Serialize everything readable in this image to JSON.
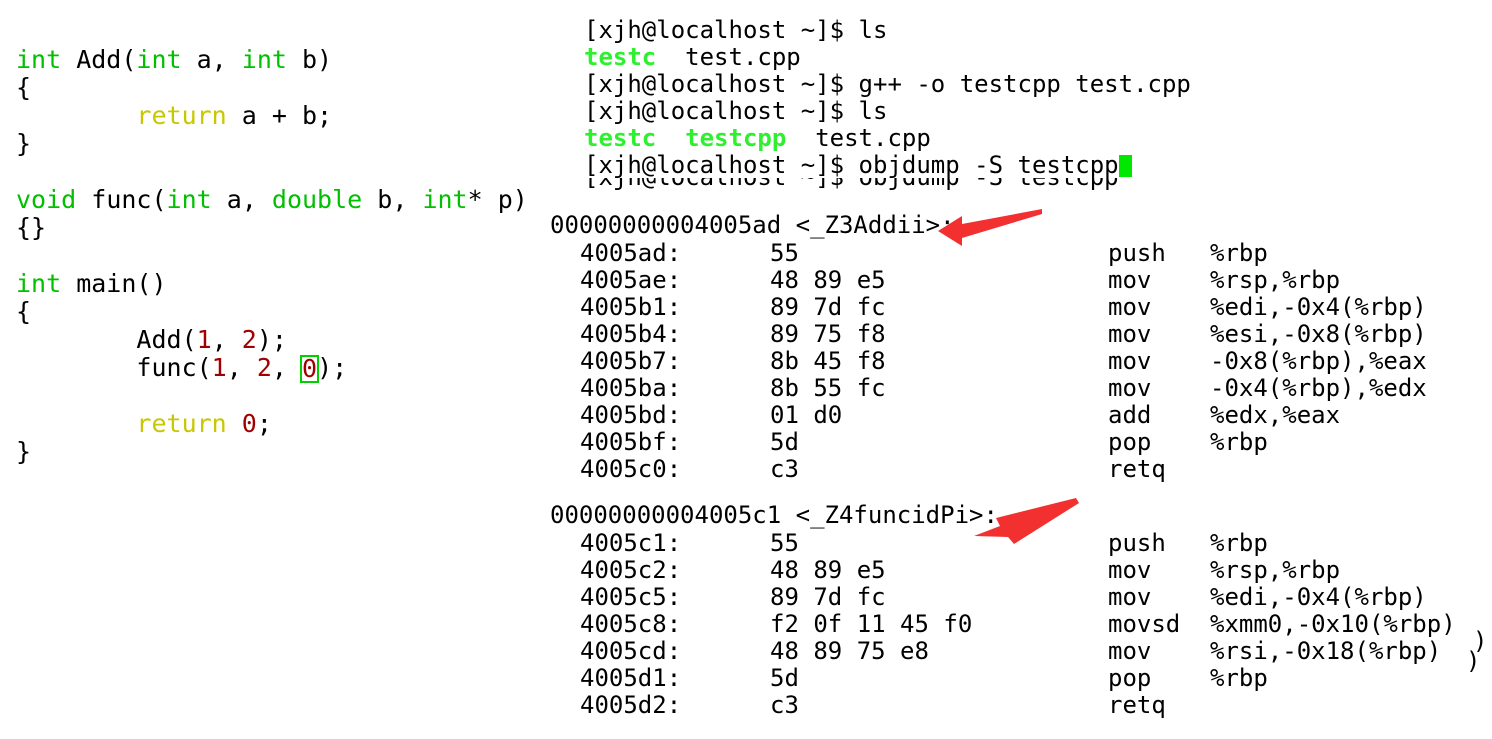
{
  "colors": {
    "background": "#ffffff",
    "keyword_green": "#00c000",
    "return_yellow": "#c8c800",
    "number_red": "#a00000",
    "executable_green": "#2ef02e",
    "cursor_green": "#00e800",
    "arrow_red": "#f23030",
    "text_black": "#000000"
  },
  "editor": {
    "lines": [
      {
        "segments": [
          {
            "t": "int",
            "c": "kw"
          },
          {
            "t": " Add(",
            "c": "plain"
          },
          {
            "t": "int",
            "c": "kw"
          },
          {
            "t": " a, ",
            "c": "plain"
          },
          {
            "t": "int",
            "c": "kw"
          },
          {
            "t": " b)",
            "c": "plain"
          }
        ]
      },
      {
        "segments": [
          {
            "t": "{",
            "c": "plain"
          }
        ]
      },
      {
        "segments": [
          {
            "t": "        ",
            "c": "plain"
          },
          {
            "t": "return",
            "c": "ret-kw"
          },
          {
            "t": " a + b;",
            "c": "plain"
          }
        ]
      },
      {
        "segments": [
          {
            "t": "}",
            "c": "plain"
          }
        ]
      },
      {
        "segments": []
      },
      {
        "segments": [
          {
            "t": "void",
            "c": "kw"
          },
          {
            "t": " func(",
            "c": "plain"
          },
          {
            "t": "int",
            "c": "kw"
          },
          {
            "t": " a, ",
            "c": "plain"
          },
          {
            "t": "double",
            "c": "kw"
          },
          {
            "t": " b, ",
            "c": "plain"
          },
          {
            "t": "int",
            "c": "kw"
          },
          {
            "t": "* p)",
            "c": "plain"
          }
        ]
      },
      {
        "segments": [
          {
            "t": "{}",
            "c": "plain"
          }
        ]
      },
      {
        "segments": []
      },
      {
        "segments": [
          {
            "t": "int",
            "c": "kw"
          },
          {
            "t": " main()",
            "c": "plain"
          }
        ]
      },
      {
        "segments": [
          {
            "t": "{",
            "c": "plain"
          }
        ]
      },
      {
        "segments": [
          {
            "t": "        Add(",
            "c": "plain"
          },
          {
            "t": "1",
            "c": "num"
          },
          {
            "t": ", ",
            "c": "plain"
          },
          {
            "t": "2",
            "c": "num"
          },
          {
            "t": ");",
            "c": "plain"
          }
        ]
      },
      {
        "segments": [
          {
            "t": "        func(",
            "c": "plain"
          },
          {
            "t": "1",
            "c": "num"
          },
          {
            "t": ", ",
            "c": "plain"
          },
          {
            "t": "2",
            "c": "num"
          },
          {
            "t": ", ",
            "c": "plain"
          },
          {
            "t": "0",
            "c": "num",
            "boxed": true
          },
          {
            "t": ");",
            "c": "plain"
          }
        ]
      },
      {
        "segments": []
      },
      {
        "segments": [
          {
            "t": "        ",
            "c": "plain"
          },
          {
            "t": "return",
            "c": "ret-kw"
          },
          {
            "t": " ",
            "c": "plain"
          },
          {
            "t": "0",
            "c": "num"
          },
          {
            "t": ";",
            "c": "plain"
          }
        ]
      },
      {
        "segments": [
          {
            "t": "}",
            "c": "plain"
          }
        ]
      }
    ]
  },
  "terminal": {
    "prompt": "[xjh@localhost ~]$ ",
    "lines": [
      {
        "type": "prompt",
        "prompt": "[xjh@localhost ~]$ ",
        "command": "ls"
      },
      {
        "type": "output",
        "segments": [
          {
            "t": "testc",
            "c": "exe"
          },
          {
            "t": "  test.cpp",
            "c": "plain"
          }
        ]
      },
      {
        "type": "prompt",
        "prompt": "[xjh@localhost ~]$ ",
        "command": "g++ -o testcpp test.cpp"
      },
      {
        "type": "prompt",
        "prompt": "[xjh@localhost ~]$ ",
        "command": "ls"
      },
      {
        "type": "output",
        "segments": [
          {
            "t": "testc",
            "c": "exe"
          },
          {
            "t": "  ",
            "c": "plain"
          },
          {
            "t": "testcpp",
            "c": "exe"
          },
          {
            "t": "  test.cpp",
            "c": "plain"
          }
        ]
      },
      {
        "type": "prompt",
        "prompt": "[xjh@localhost ~]$ ",
        "command": "objdump -S testcpp",
        "cursor": true
      }
    ],
    "clipped_partial_line": "[xjh@localhost ~]$ objdump -S testcpp"
  },
  "disassembly": {
    "blocks": [
      {
        "header": "00000000004005ad <_Z3Addii>:",
        "rows": [
          {
            "addr": "4005ad:",
            "bytes": "55",
            "mnemonic": "push",
            "operands": "%rbp"
          },
          {
            "addr": "4005ae:",
            "bytes": "48 89 e5",
            "mnemonic": "mov",
            "operands": "%rsp,%rbp"
          },
          {
            "addr": "4005b1:",
            "bytes": "89 7d fc",
            "mnemonic": "mov",
            "operands": "%edi,-0x4(%rbp)"
          },
          {
            "addr": "4005b4:",
            "bytes": "89 75 f8",
            "mnemonic": "mov",
            "operands": "%esi,-0x8(%rbp)"
          },
          {
            "addr": "4005b7:",
            "bytes": "8b 45 f8",
            "mnemonic": "mov",
            "operands": "-0x8(%rbp),%eax"
          },
          {
            "addr": "4005ba:",
            "bytes": "8b 55 fc",
            "mnemonic": "mov",
            "operands": "-0x4(%rbp),%edx"
          },
          {
            "addr": "4005bd:",
            "bytes": "01 d0",
            "mnemonic": "add",
            "operands": "%edx,%eax"
          },
          {
            "addr": "4005bf:",
            "bytes": "5d",
            "mnemonic": "pop",
            "operands": "%rbp"
          },
          {
            "addr": "4005c0:",
            "bytes": "c3",
            "mnemonic": "retq",
            "operands": ""
          }
        ]
      },
      {
        "header": "00000000004005c1 <_Z4funcidPi>:",
        "rows": [
          {
            "addr": "4005c1:",
            "bytes": "55",
            "mnemonic": "push",
            "operands": "%rbp"
          },
          {
            "addr": "4005c2:",
            "bytes": "48 89 e5",
            "mnemonic": "mov",
            "operands": "%rsp,%rbp"
          },
          {
            "addr": "4005c5:",
            "bytes": "89 7d fc",
            "mnemonic": "mov",
            "operands": "%edi,-0x4(%rbp)"
          },
          {
            "addr": "4005c8:",
            "bytes": "f2 0f 11 45 f0",
            "mnemonic": "movsd",
            "operands": "%xmm0,-0x10(%rbp)"
          },
          {
            "addr": "4005cd:",
            "bytes": "48 89 75 e8",
            "mnemonic": "mov",
            "operands": "%rsi,-0x18(%rbp)"
          },
          {
            "addr": "4005d1:",
            "bytes": "5d",
            "mnemonic": "pop",
            "operands": "%rbp"
          },
          {
            "addr": "4005d2:",
            "bytes": "c3",
            "mnemonic": "retq",
            "operands": ""
          }
        ]
      }
    ],
    "edge_fragments": [
      ")",
      ")"
    ]
  },
  "annotations": {
    "arrows": [
      {
        "name": "arrow-to-z3addii",
        "points_at": "00000000004005ad <_Z3Addii>:"
      },
      {
        "name": "arrow-to-z4funcidpi",
        "points_at": "00000000004005c1 <_Z4funcidPi>:"
      }
    ]
  }
}
